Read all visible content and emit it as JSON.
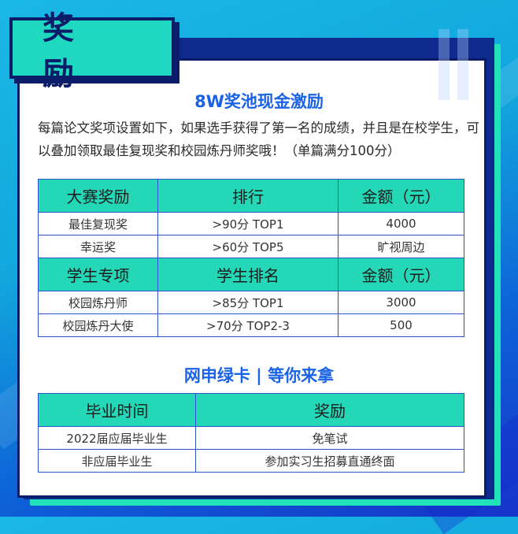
{
  "badge_title": "奖 励",
  "section1": {
    "heading": "8W奖池现金激励",
    "intro": "每篇论文奖项设置如下，如果选手获得了第一名的成绩，并且是在校学生，可以叠加领取最佳复现奖和校园炼丹师奖哦！（单篇满分100分）"
  },
  "table1": {
    "header1": [
      "大赛奖励",
      "排行",
      "金额（元）"
    ],
    "rows1": [
      [
        "最佳复现奖",
        ">90分 TOP1",
        "4000"
      ],
      [
        "幸运奖",
        ">60分 TOP5",
        "旷视周边"
      ]
    ],
    "header2": [
      "学生专项",
      "学生排名",
      "金额（元）"
    ],
    "rows2": [
      [
        "校园炼丹师",
        ">85分 TOP1",
        "3000"
      ],
      [
        "校园炼丹大使",
        ">70分 TOP2-3",
        "500"
      ]
    ]
  },
  "section2": {
    "heading": "网申绿卡 | 等你来拿"
  },
  "table2": {
    "header": [
      "毕业时间",
      "奖励"
    ],
    "rows": [
      [
        "2022届应届毕业生",
        "免笔试"
      ],
      [
        "非应届毕业生",
        "参加实习生招募直通终面"
      ]
    ]
  },
  "colors": {
    "accent_teal": "#24d7b7",
    "heading_blue": "#1a62e6",
    "navy": "#0b1d68",
    "border_blue": "#2c54c9"
  }
}
